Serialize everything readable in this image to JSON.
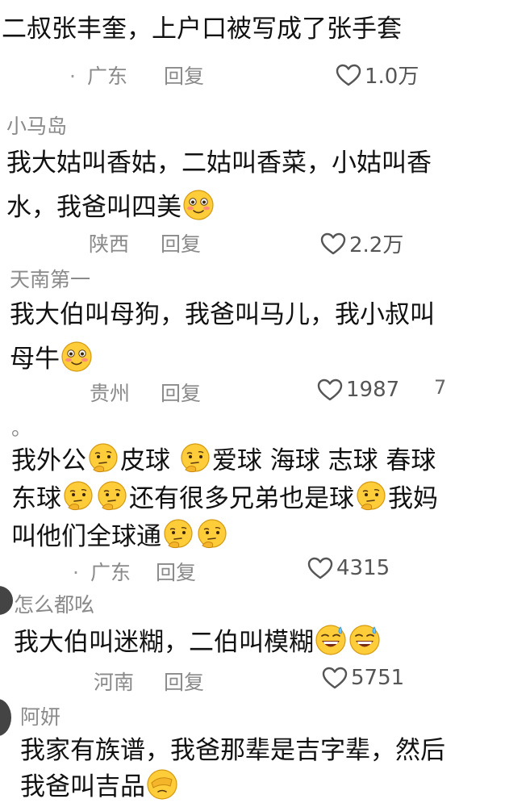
{
  "comments": [
    {
      "line1": "二叔张丰奎，上户口被写成了张手套",
      "location": "广东",
      "reply": "回复",
      "likes": "1.0万"
    },
    {
      "user": "小马岛",
      "line1": "我大姑叫香姑，二姑叫香菜，小姑叫香",
      "line2": "水，我爸叫四美",
      "location": "陕西",
      "reply": "回复",
      "likes": "2.2万"
    },
    {
      "user": "天南第一",
      "line1": "我大伯叫母狗，我爸叫马儿，我小叔叫",
      "line2": "母牛",
      "location": "贵州",
      "reply": "回复",
      "likes": "1987",
      "stray": "7"
    },
    {
      "user": "。",
      "line1_a": "我外公",
      "line1_b": "皮球",
      "line1_c": "爱球 海球 志球 春球",
      "line2_a": "东球",
      "line2_b": "还有很多兄弟也是球",
      "line2_c": "我妈",
      "line3": "叫他们全球通",
      "location": "广东",
      "reply": "回复",
      "likes": "4315"
    },
    {
      "user": "怎么都吆",
      "line1": "我大伯叫迷糊，二伯叫模糊",
      "location": "河南",
      "reply": "回复",
      "likes": "5751"
    },
    {
      "user": "阿妍",
      "line1": "我家有族谱，我爸那辈是吉字辈，然后",
      "line2": "我爸叫吉品"
    }
  ],
  "colors": {
    "text": "#111111",
    "meta": "#8a8a8a",
    "emoji_face": "#ffcc3a"
  }
}
